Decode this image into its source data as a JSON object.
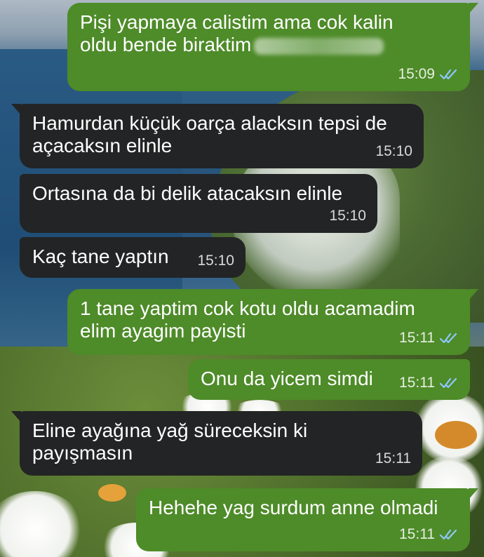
{
  "chat": {
    "messages": [
      {
        "direction": "outgoing",
        "text": "Pişi yapmaya calistim ama cok kalin\noldu bende biraktim",
        "time": "15:09",
        "status_icon": "double-check-icon",
        "redacted": true
      },
      {
        "direction": "incoming",
        "text": "Hamurdan küçük oarça alacksın tepsi de\naçacaksın elinle",
        "time": "15:10"
      },
      {
        "direction": "incoming",
        "text": "Ortasına da bi delik atacaksın elinle",
        "time": "15:10"
      },
      {
        "direction": "incoming",
        "text": "Kaç tane yaptın",
        "time": "15:10"
      },
      {
        "direction": "outgoing",
        "text": "1 tane yaptim cok kotu oldu acamadim\nelim ayagim payisti",
        "time": "15:11",
        "status_icon": "double-check-icon"
      },
      {
        "direction": "outgoing",
        "text": "Onu da yicem simdi",
        "time": "15:11",
        "status_icon": "double-check-icon"
      },
      {
        "direction": "incoming",
        "text": "Eline ayağına yağ süreceksin ki\npayışmasın",
        "time": "15:11"
      },
      {
        "direction": "outgoing",
        "text": "Hehehe yag surdum anne olmadi",
        "time": "15:11",
        "status_icon": "double-check-icon"
      }
    ]
  },
  "colors": {
    "outgoing_bubble": "#4e8b29",
    "incoming_bubble": "#232425",
    "read_ticks": "#8fc7ff"
  }
}
